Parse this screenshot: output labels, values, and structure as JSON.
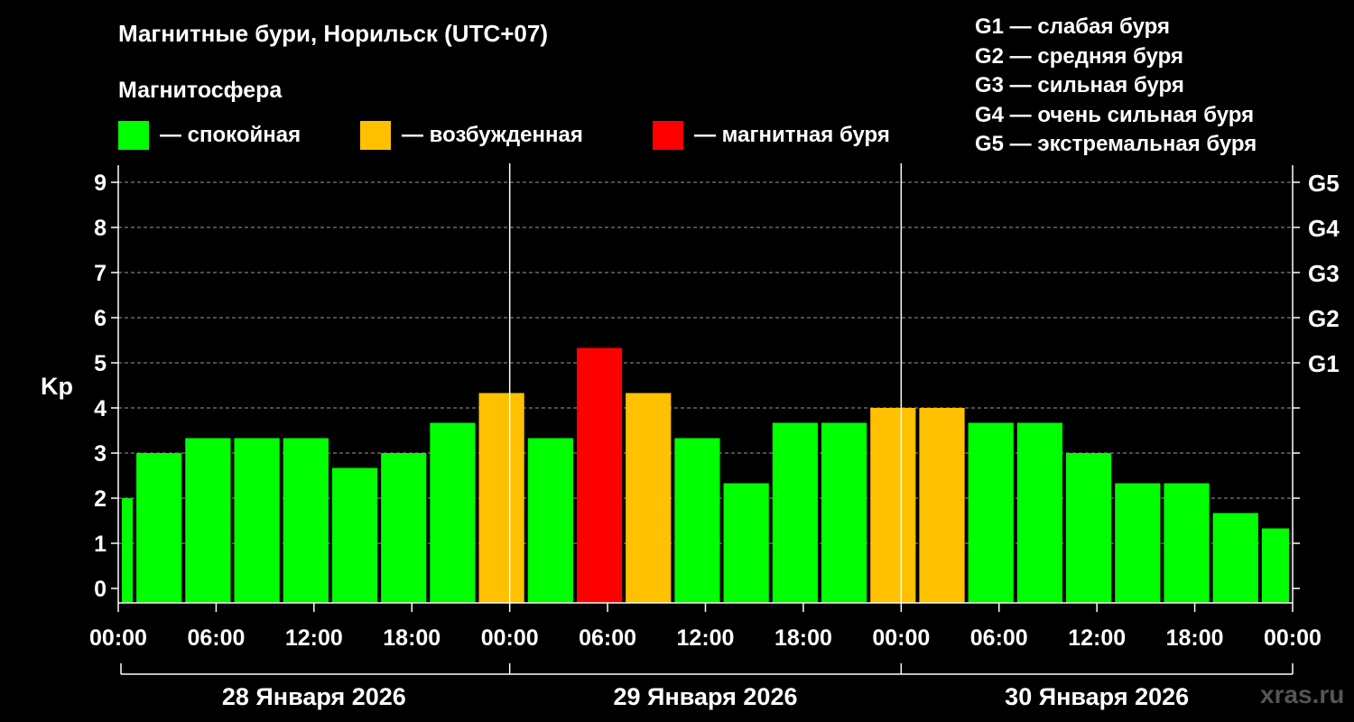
{
  "header": {
    "title": "Магнитные бури, Норильск (UTC+07)",
    "subtitle": "Магнитосфера"
  },
  "legend": [
    {
      "color": "#00ff00",
      "label": "— спокойная"
    },
    {
      "color": "#ffc000",
      "label": "— возбужденная"
    },
    {
      "color": "#ff0000",
      "label": "— магнитная буря"
    }
  ],
  "g_scale": [
    "G1 — слабая буря",
    "G2 — средняя буря",
    "G3 — сильная буря",
    "G4 — очень сильная буря",
    "G5 — экстремальная буря"
  ],
  "watermark": "xras.ru",
  "chart_data": {
    "type": "bar",
    "ylabel": "Kp",
    "ylim": [
      0,
      9
    ],
    "yticks": [
      "0",
      "1",
      "2",
      "3",
      "4",
      "5",
      "6",
      "7",
      "8",
      "9"
    ],
    "right_ticks": [
      {
        "value": 5,
        "label": "G1"
      },
      {
        "value": 6,
        "label": "G2"
      },
      {
        "value": 7,
        "label": "G3"
      },
      {
        "value": 8,
        "label": "G4"
      },
      {
        "value": 9,
        "label": "G5"
      }
    ],
    "grid": "dashed horizontal",
    "x_range_hours": [
      0,
      72
    ],
    "xticks": [
      "00:00",
      "06:00",
      "12:00",
      "18:00",
      "00:00",
      "06:00",
      "12:00",
      "18:00",
      "00:00",
      "06:00",
      "12:00",
      "18:00",
      "00:00"
    ],
    "days": [
      "28 Января 2026",
      "29 Января 2026",
      "30 Января 2026"
    ],
    "colors": {
      "calm": "#00ff00",
      "active": "#ffc000",
      "storm": "#ff0000"
    },
    "bars": [
      {
        "start": 0,
        "end": 1,
        "kp": 2.0,
        "level": "calm"
      },
      {
        "start": 1,
        "end": 4,
        "kp": 3.0,
        "level": "calm"
      },
      {
        "start": 4,
        "end": 7,
        "kp": 3.33,
        "level": "calm"
      },
      {
        "start": 7,
        "end": 10,
        "kp": 3.33,
        "level": "calm"
      },
      {
        "start": 10,
        "end": 13,
        "kp": 3.33,
        "level": "calm"
      },
      {
        "start": 13,
        "end": 16,
        "kp": 2.67,
        "level": "calm"
      },
      {
        "start": 16,
        "end": 19,
        "kp": 3.0,
        "level": "calm"
      },
      {
        "start": 19,
        "end": 22,
        "kp": 3.67,
        "level": "calm"
      },
      {
        "start": 22,
        "end": 25,
        "kp": 4.33,
        "level": "active"
      },
      {
        "start": 25,
        "end": 28,
        "kp": 3.33,
        "level": "calm"
      },
      {
        "start": 28,
        "end": 31,
        "kp": 5.33,
        "level": "storm"
      },
      {
        "start": 31,
        "end": 34,
        "kp": 4.33,
        "level": "active"
      },
      {
        "start": 34,
        "end": 37,
        "kp": 3.33,
        "level": "calm"
      },
      {
        "start": 37,
        "end": 40,
        "kp": 2.33,
        "level": "calm"
      },
      {
        "start": 40,
        "end": 43,
        "kp": 3.67,
        "level": "calm"
      },
      {
        "start": 43,
        "end": 46,
        "kp": 3.67,
        "level": "calm"
      },
      {
        "start": 46,
        "end": 49,
        "kp": 4.0,
        "level": "active"
      },
      {
        "start": 49,
        "end": 52,
        "kp": 4.0,
        "level": "active"
      },
      {
        "start": 52,
        "end": 55,
        "kp": 3.67,
        "level": "calm"
      },
      {
        "start": 55,
        "end": 58,
        "kp": 3.67,
        "level": "calm"
      },
      {
        "start": 58,
        "end": 61,
        "kp": 3.0,
        "level": "calm"
      },
      {
        "start": 61,
        "end": 64,
        "kp": 2.33,
        "level": "calm"
      },
      {
        "start": 64,
        "end": 67,
        "kp": 2.33,
        "level": "calm"
      },
      {
        "start": 67,
        "end": 70,
        "kp": 1.67,
        "level": "calm"
      },
      {
        "start": 70,
        "end": 72,
        "kp": 1.33,
        "level": "calm"
      }
    ]
  }
}
